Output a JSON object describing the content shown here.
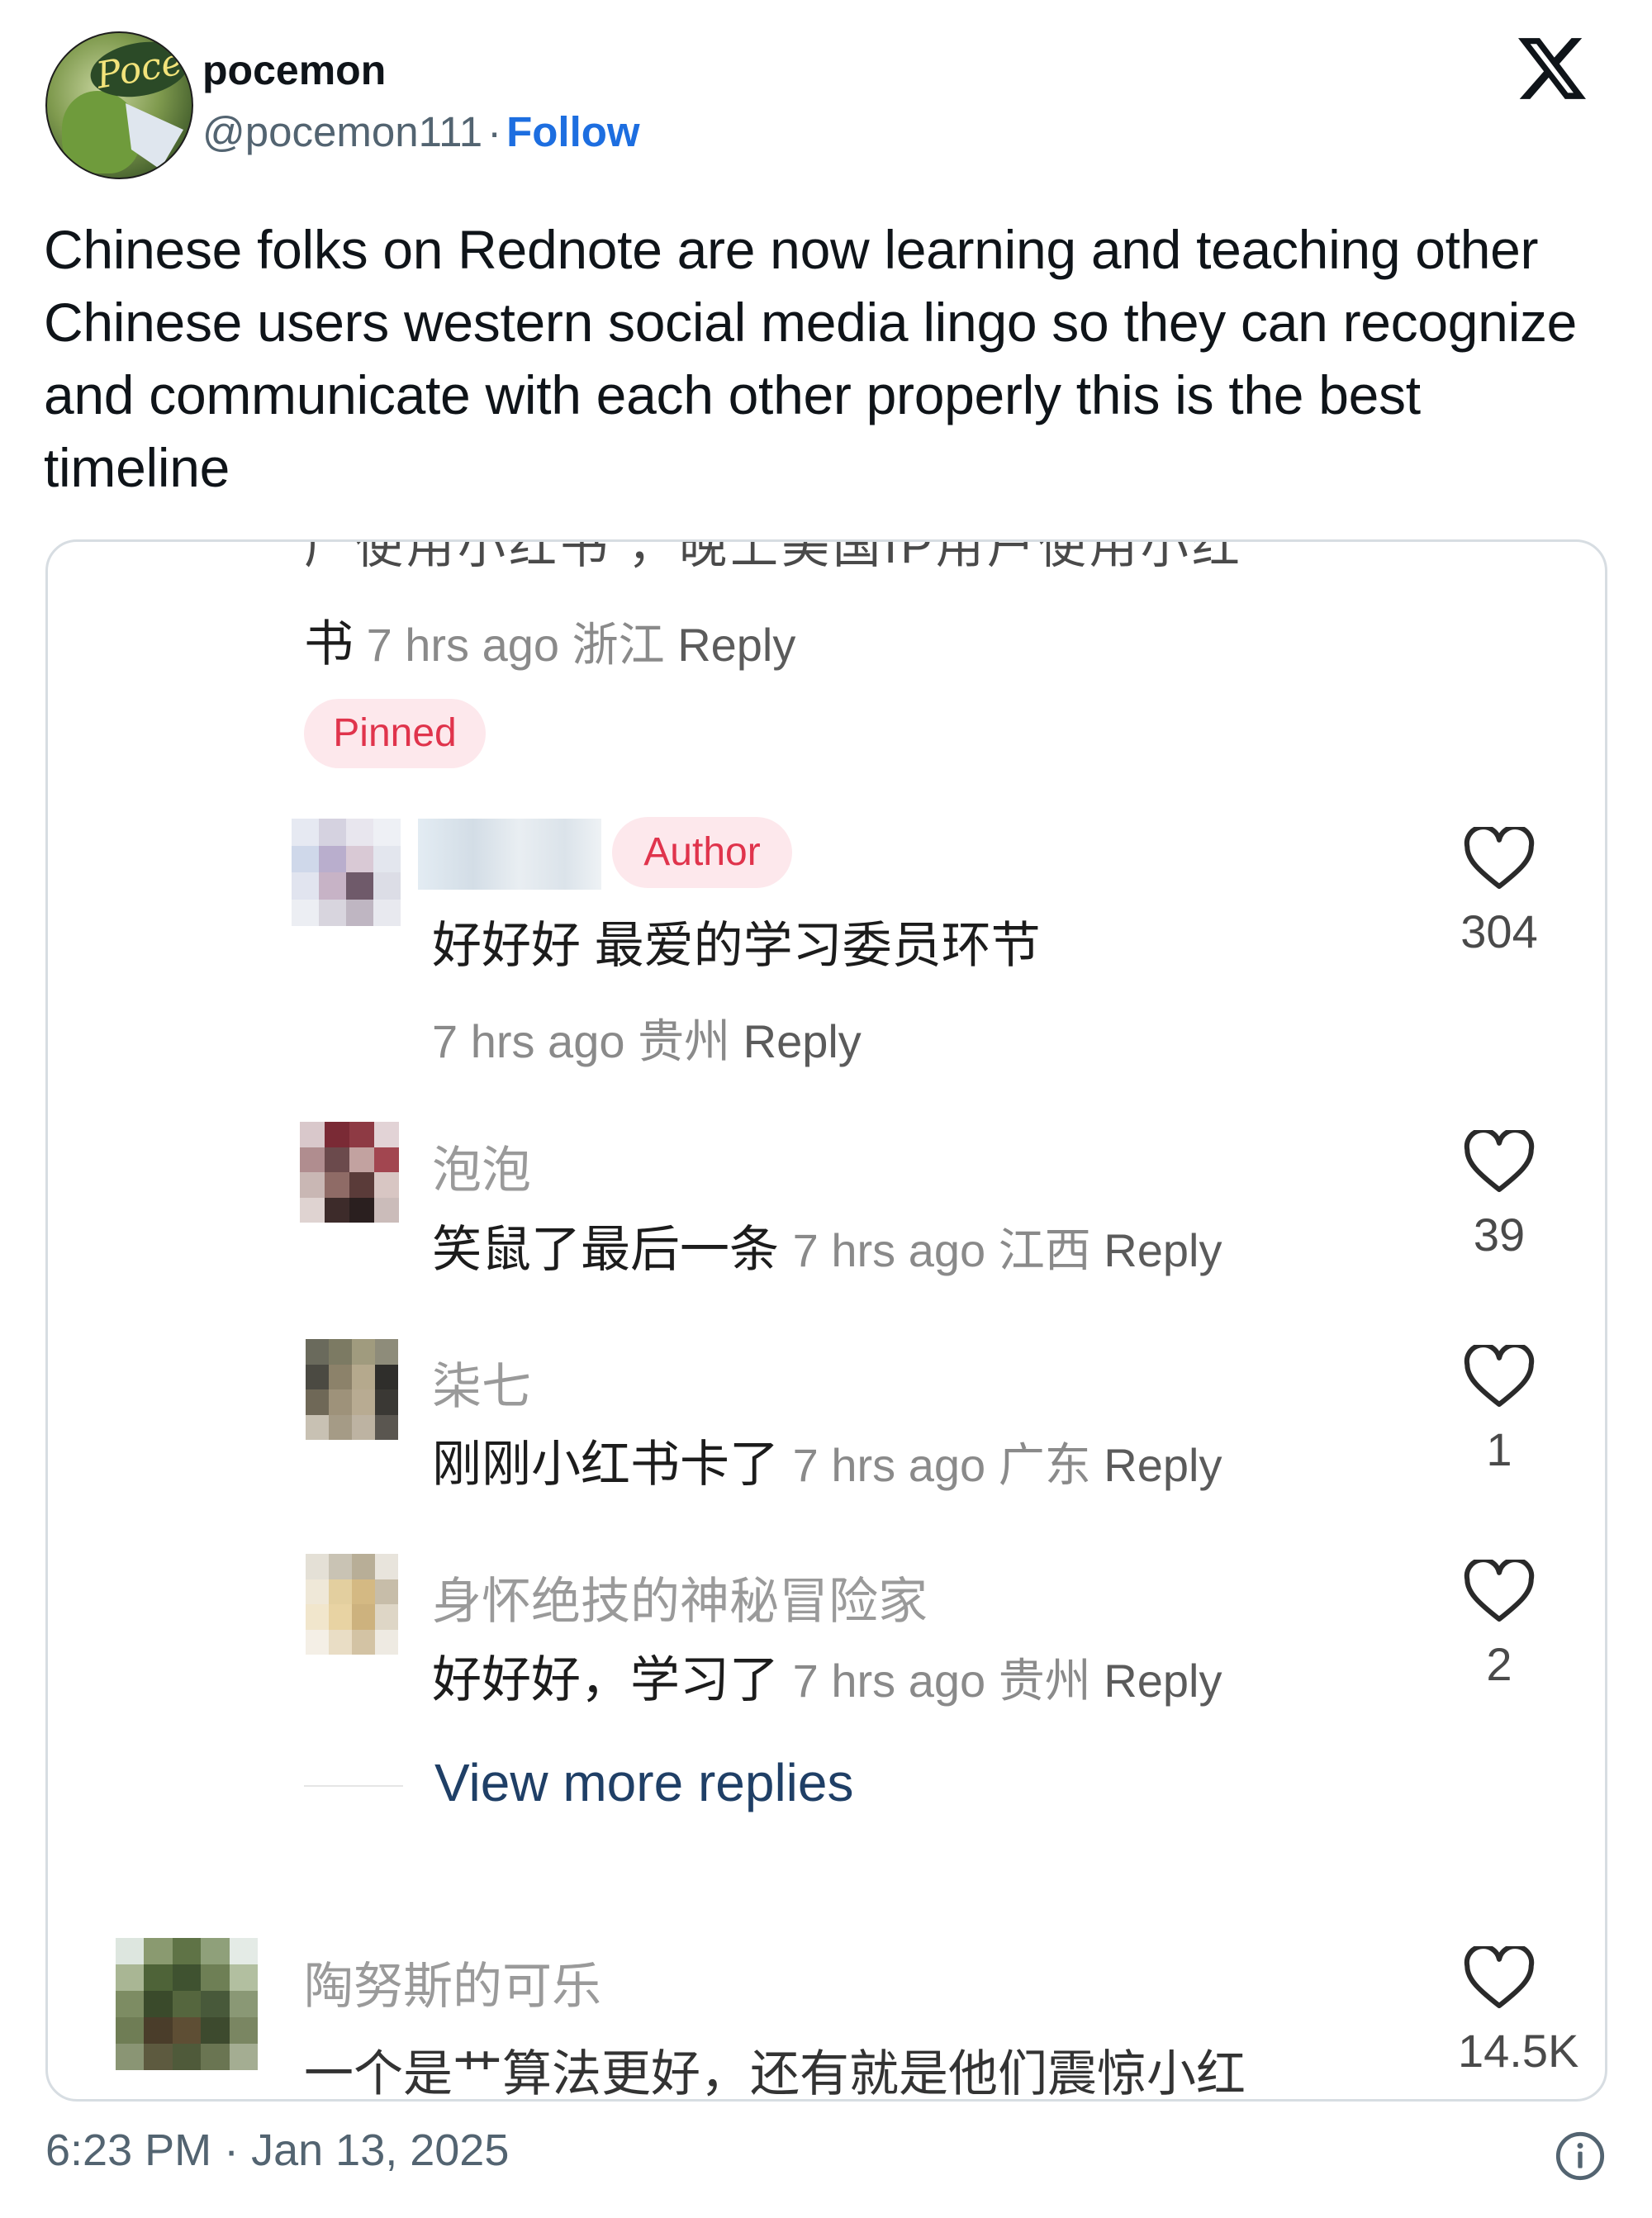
{
  "author": {
    "name": "pocemon",
    "handle": "@pocemon111",
    "separator": "·",
    "follow_label": "Follow",
    "avatar_badge": "Poce"
  },
  "tweet": {
    "text": "Chinese folks on Rednote are now learning and teaching other Chinese users western social media lingo so they can recognize and communicate with each other properly this is the best timeline",
    "timestamp": "6:23 PM · Jan 13, 2025"
  },
  "screenshot": {
    "top_cut_text": "广使用小红书 ，晚上美国IP用户使用小红",
    "top_meta": {
      "lead": "书",
      "time": "7 hrs ago",
      "location": "浙江",
      "reply": "Reply"
    },
    "pinned_label": "Pinned",
    "author_badge": "Author",
    "comments": [
      {
        "name": "",
        "text": "好好好 最爱的学习委员环节",
        "time": "7 hrs ago",
        "location": "贵州",
        "reply": "Reply",
        "likes": "304"
      },
      {
        "name": "泡泡",
        "text": "笑鼠了最后一条",
        "time": "7 hrs ago",
        "location": "江西",
        "reply": "Reply",
        "likes": "39"
      },
      {
        "name": "柒七",
        "text": "刚刚小红书卡了",
        "time": "7 hrs ago",
        "location": "广东",
        "reply": "Reply",
        "likes": "1"
      },
      {
        "name": "身怀绝技的神秘冒险家",
        "text": "好好好，学习了",
        "time": "7 hrs ago",
        "location": "贵州",
        "reply": "Reply",
        "likes": "2"
      }
    ],
    "view_more": "View more replies",
    "last_comment": {
      "name": "陶努斯的可乐",
      "text_cut": "一个是艹算法更好，还有就是他们震惊小红",
      "likes": "14.5K"
    }
  },
  "colors": {
    "follow": "#1d6ee0",
    "badge_bg": "#fde8ec",
    "badge_text": "#e0344c",
    "view_more": "#1f3f66"
  }
}
